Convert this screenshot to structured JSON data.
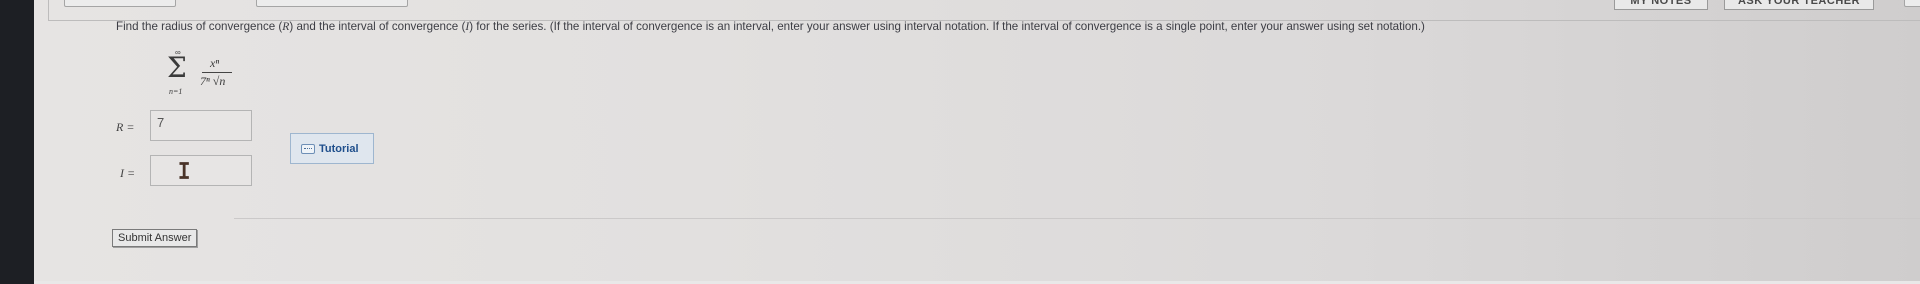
{
  "toolbar": {
    "my_notes_label": "MY NOTES",
    "ask_teacher_label": "ASK YOUR TEACHER"
  },
  "question": {
    "text_before_R": "Find the radius of convergence (",
    "var_R": "R",
    "text_between": ") and the interval of convergence (",
    "var_I": "I",
    "text_after": ") for the series. (If the interval of convergence is an interval, enter your answer using interval notation. If the interval of convergence is a single point, enter your answer using set notation.)"
  },
  "series": {
    "sigma": "Σ",
    "upper_limit": "∞",
    "lower_limit": "n=1",
    "numerator": "xⁿ",
    "denominator": "7ⁿ √n"
  },
  "answers": {
    "R_label": "R  =",
    "R_value": "7",
    "R_status": "correct",
    "I_label": "I  =",
    "I_value": ""
  },
  "tutorial": {
    "label": "Tutorial"
  },
  "submit": {
    "label": "Submit Answer"
  },
  "colors": {
    "check": "#5b9a3c",
    "tutorial_text": "#1f4f8c"
  }
}
